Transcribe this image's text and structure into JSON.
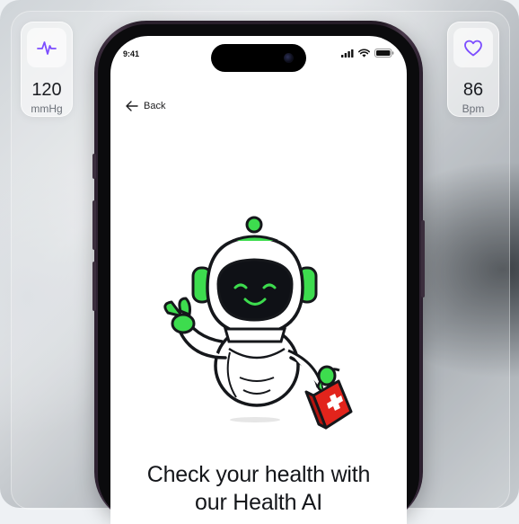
{
  "vitals": {
    "blood_pressure": {
      "value": "120",
      "unit": "mmHg",
      "icon": "heartbeat-pulse-icon",
      "accent": "#7c4dff"
    },
    "heart_rate": {
      "value": "86",
      "unit": "Bpm",
      "icon": "heart-outline-icon",
      "accent": "#7c4dff"
    }
  },
  "status_bar": {
    "time": "9:41"
  },
  "nav": {
    "back_label": "Back"
  },
  "hero": {
    "headline_line1": "Check your health with",
    "headline_line2": "our Health AI"
  },
  "colors": {
    "brand_green": "#3ddc4e",
    "kit_red": "#e2241c"
  }
}
